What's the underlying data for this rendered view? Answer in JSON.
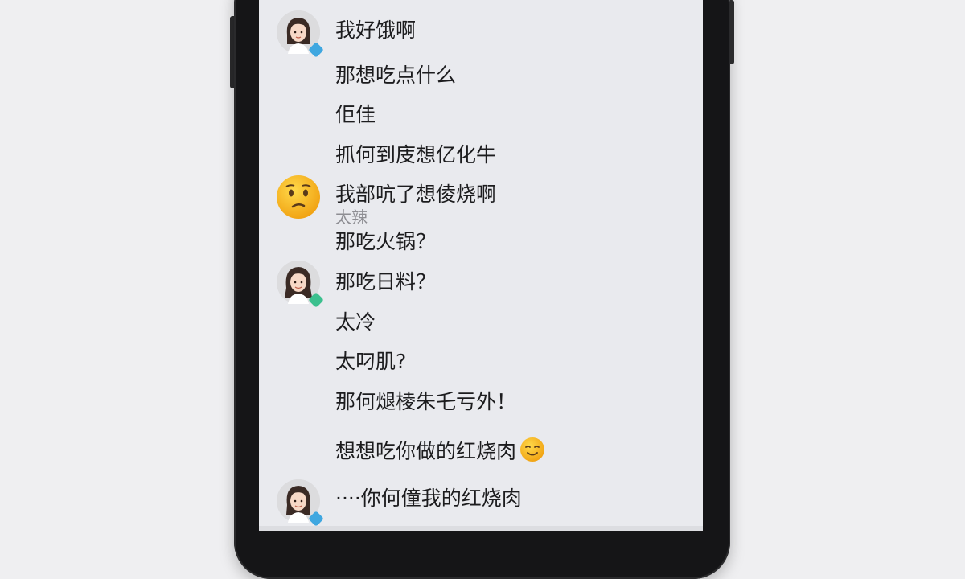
{
  "chat": {
    "messages": [
      {
        "text": "我好饿啊"
      },
      {
        "text": "那想吃点什么"
      },
      {
        "text": "佢佳"
      },
      {
        "text": "抓何到庋想亿化牛"
      },
      {
        "text": "我部吭了想倰烧啊"
      },
      {
        "text": "太辣"
      },
      {
        "text": "那吃火锅？"
      },
      {
        "text": "那吃日料？"
      },
      {
        "text": "太冷"
      },
      {
        "text": "太叼肌?"
      },
      {
        "text": "那何煺棱朱乇亏外！"
      },
      {
        "text": "想想吃你做的红烧肉"
      },
      {
        "text": "····你何僮我的红烧肉"
      }
    ]
  },
  "icons": {
    "avatar": "girl-avatar-icon",
    "confused_emoji": "confused-face-emoji-icon",
    "wink_emoji": "smiling-face-emoji-icon"
  },
  "colors": {
    "screen_bg": "#e9eaee",
    "frame": "#151517",
    "badge_blue": "#3fa7e0",
    "badge_green": "#3cc08e",
    "emoji_yellow": "#f6b21c"
  }
}
